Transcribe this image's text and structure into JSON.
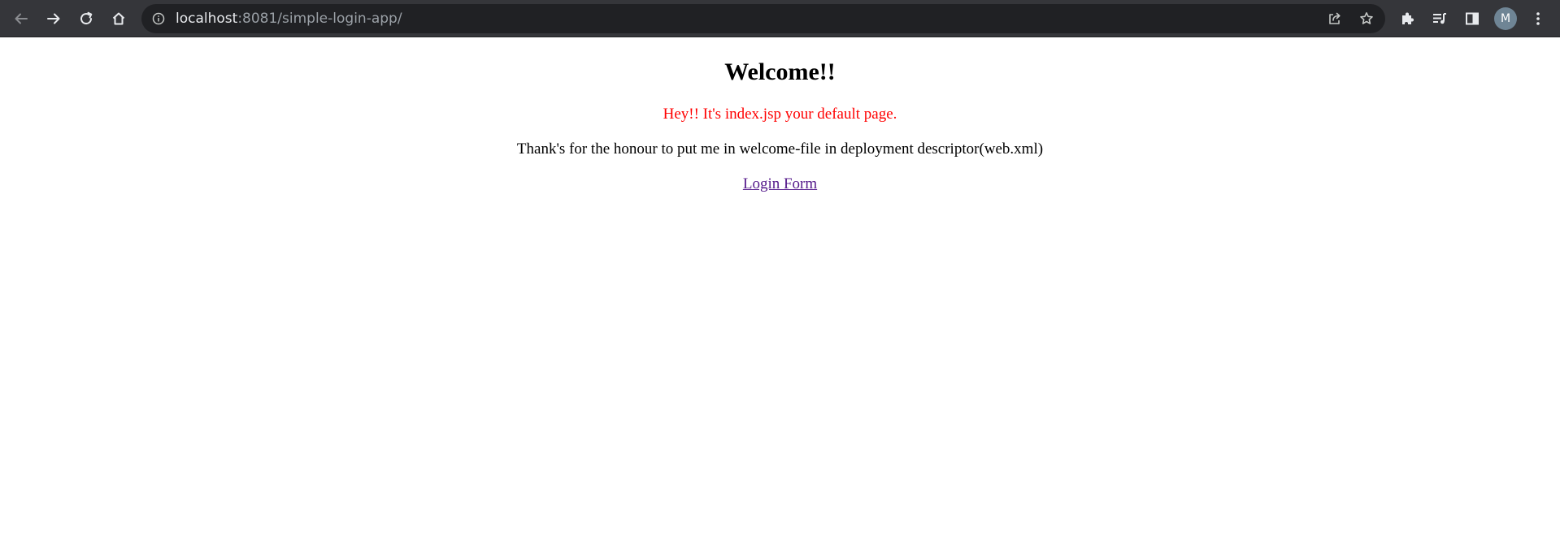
{
  "browser": {
    "url_host": "localhost",
    "url_rest": ":8081/simple-login-app/",
    "profile_initial": "M"
  },
  "page": {
    "heading": "Welcome!!",
    "default_message": "Hey!! It's index.jsp your default page.",
    "thanks_message": "Thank's for the honour to put me in welcome-file in deployment descriptor(web.xml)",
    "login_link": "Login Form"
  },
  "colors": {
    "toolbar_bg": "#35363a",
    "omnibox_bg": "#202124",
    "default_message": "#ff0000",
    "visited_link": "#551a8b"
  }
}
